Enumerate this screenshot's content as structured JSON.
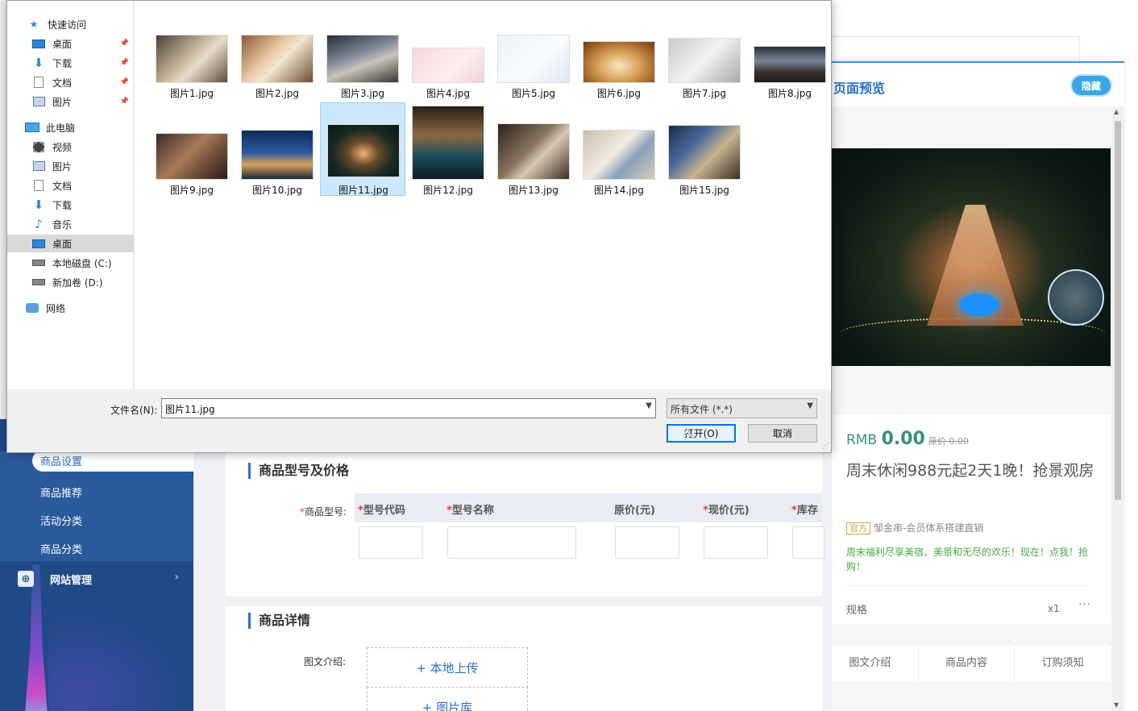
{
  "dialog": {
    "nav": {
      "quick_access": "快速访问",
      "quick_items": [
        "桌面",
        "下载",
        "文档",
        "图片"
      ],
      "this_pc": "此电脑",
      "pc_items": [
        "视频",
        "图片",
        "文档",
        "下载",
        "音乐",
        "桌面"
      ],
      "drives": [
        "本地磁盘 (C:)",
        "新加卷 (D:)"
      ],
      "network": "网络"
    },
    "files": [
      "图片1.jpg",
      "图片2.jpg",
      "图片3.jpg",
      "图片4.jpg",
      "图片5.jpg",
      "图片6.jpg",
      "图片7.jpg",
      "图片8.jpg",
      "图片9.jpg",
      "图片10.jpg",
      "图片11.jpg",
      "图片12.jpg",
      "图片13.jpg",
      "图片14.jpg",
      "图片15.jpg"
    ],
    "filename_label": "文件名(N):",
    "filename_value": "图片11.jpg",
    "filetype_value": "所有文件 (*.*)",
    "open_label": "打开(O)",
    "cancel_label": "取消"
  },
  "sidebar": {
    "items": [
      "商品设置",
      "商品推荐",
      "活动分类",
      "商品分类"
    ],
    "website": "网站管理"
  },
  "main": {
    "section_model": "商品型号及价格",
    "model_label": "商品型号:",
    "columns": [
      "型号代码",
      "型号名称",
      "原价(元)",
      "现价(元)",
      "库存"
    ],
    "section_detail": "商品详情",
    "detail_label": "图文介绍:",
    "upload_local": "+ 本地上传",
    "upload_library": "+ 图片库"
  },
  "preview": {
    "title": "页面预览",
    "hide_label": "隐藏",
    "currency": "RMB",
    "price": "0.00",
    "orig_price": "原价 0.00",
    "product_title": "周末休闲988元起2天1晚！抢景观房",
    "tag": "官方",
    "seller": "邹金串-会员体系搭建直销",
    "promo": "周末福利尽享美宿、美景和无尽的欢乐！现在！点我！抢购！",
    "spec_label": "规格",
    "spec_qty": "x1",
    "tabs": [
      "图文介绍",
      "商品内容",
      "订购须知"
    ]
  }
}
